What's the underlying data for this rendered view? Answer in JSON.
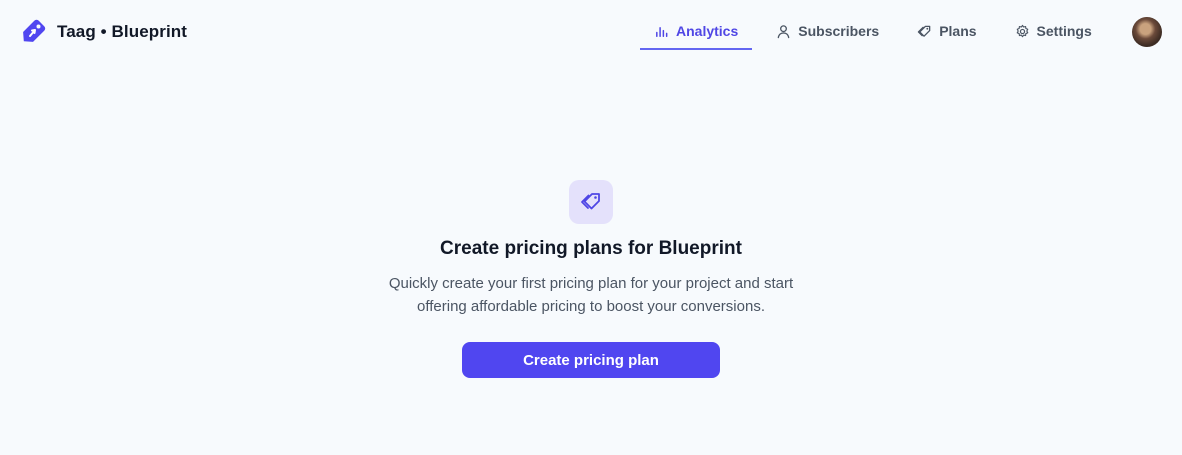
{
  "brand": {
    "name": "Taag • Blueprint",
    "logo_icon": "tag-icon",
    "accent_color": "#5046f0"
  },
  "nav": {
    "items": [
      {
        "label": "Analytics",
        "icon": "bar-chart-icon",
        "active": true
      },
      {
        "label": "Subscribers",
        "icon": "user-icon",
        "active": false
      },
      {
        "label": "Plans",
        "icon": "tag-outline-icon",
        "active": false
      },
      {
        "label": "Settings",
        "icon": "gear-icon",
        "active": false
      }
    ]
  },
  "user": {
    "avatar_icon": "avatar"
  },
  "empty_state": {
    "icon": "tags-icon",
    "title": "Create pricing plans for Blueprint",
    "description": "Quickly create your first pricing plan for your project and start offering affordable pricing to boost your conversions.",
    "button_label": "Create pricing plan"
  }
}
